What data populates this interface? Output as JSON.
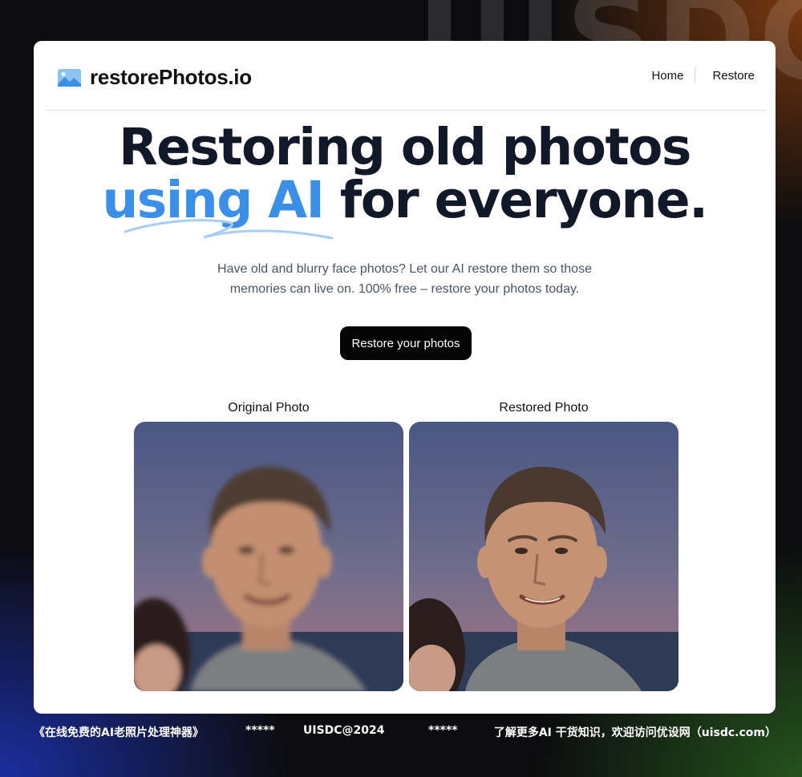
{
  "watermark": "UISDC",
  "header": {
    "brand": "restorePhotos.io",
    "brand_icon": "image-icon",
    "nav": [
      "Home",
      "Restore"
    ]
  },
  "hero": {
    "line1": "Restoring old photos",
    "accent": "using AI",
    "line2_rest": " for everyone.",
    "accent_color": "#3b8fe6"
  },
  "subtitle": {
    "line1": "Have old and blurry face photos? Let our AI restore them so those",
    "line2": "memories can live on. 100% free – restore your photos today."
  },
  "cta": "Restore your photos",
  "comparison": {
    "original_label": "Original Photo",
    "restored_label": "Restored Photo"
  },
  "footer": {
    "title": "《在线免费的AI老照片处理神器》",
    "stars_left": "*****",
    "copyright": "UISDC@2024",
    "stars_right": "*****",
    "promo": "了解更多AI 干货知识，欢迎访问优设网（uisdc.com）"
  }
}
